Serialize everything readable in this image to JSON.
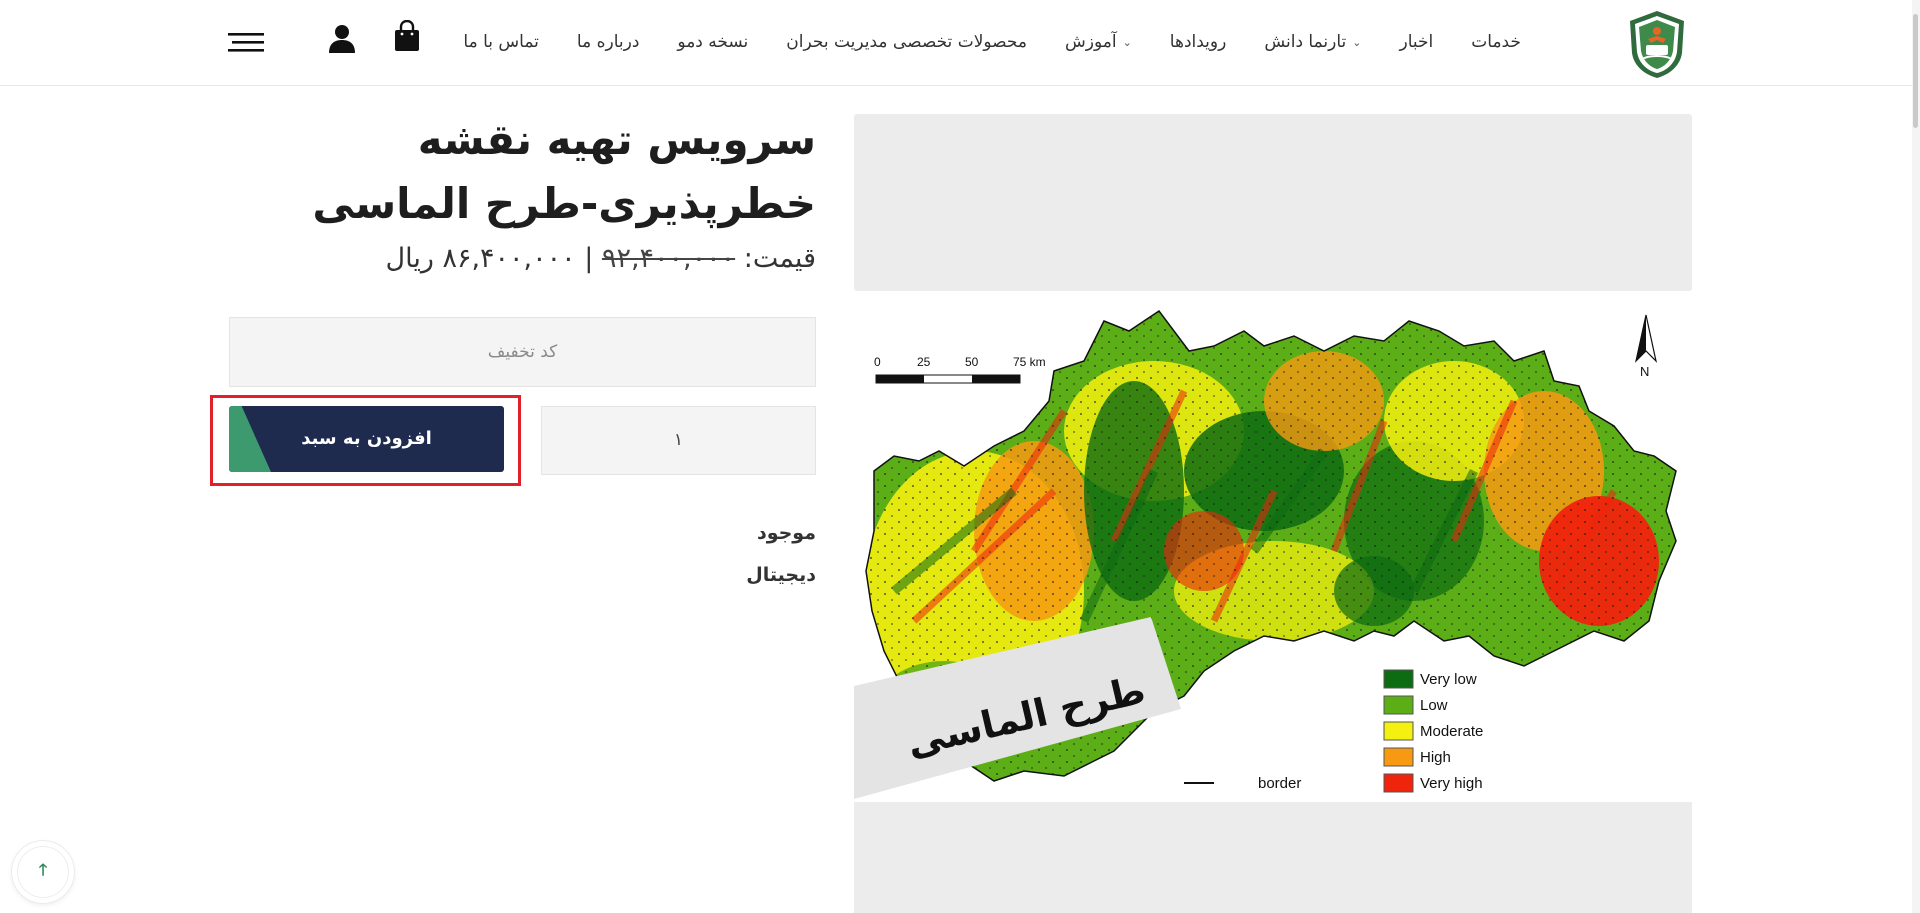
{
  "header": {
    "logo_icon": "organization-logo-icon",
    "nav": [
      {
        "label": "خدمات",
        "dropdown": false
      },
      {
        "label": "اخبار",
        "dropdown": false
      },
      {
        "label": "تارنما دانش",
        "dropdown": true
      },
      {
        "label": "رویدادها",
        "dropdown": false
      },
      {
        "label": "آموزش",
        "dropdown": true
      },
      {
        "label": "محصولات تخصصی مدیریت بحران",
        "dropdown": false
      },
      {
        "label": "نسخه دمو",
        "dropdown": false
      },
      {
        "label": "درباره ما",
        "dropdown": false
      },
      {
        "label": "تماس با ما",
        "dropdown": false
      }
    ],
    "icons": {
      "cart": "shopping-bag-icon",
      "user": "user-icon",
      "menu": "hamburger-menu-icon"
    }
  },
  "product": {
    "title_line1": "سرویس تهیه نقشه",
    "title_line2": "خطرپذیری-طرح الماسی",
    "price_label": "قیمت:",
    "price_old": "۹۲,۴۰۰,۰۰۰",
    "price_sep": "|",
    "price_new": "۸۶,۴۰۰,۰۰۰ ریال",
    "discount_placeholder": "کد تخفیف",
    "quantity": "۱",
    "add_to_cart": "افزودن به سبد",
    "stock": "موجود",
    "type": "دیجیتال"
  },
  "map": {
    "scale_ticks": [
      "0",
      "25",
      "50",
      "75 km"
    ],
    "north": "N",
    "stamp": "طرح الماسی",
    "legend": [
      {
        "label": "Very low",
        "color": "#0d6b12"
      },
      {
        "label": "Low",
        "color": "#5cae16"
      },
      {
        "label": "Moderate",
        "color": "#f4f00f"
      },
      {
        "label": "High",
        "color": "#f79a12"
      },
      {
        "label": "Very high",
        "color": "#f0230d"
      }
    ],
    "border_label": "border"
  },
  "colors": {
    "button": "#1e2b4f",
    "accent_green": "#3c9a6e",
    "highlight": "#e0202a"
  }
}
